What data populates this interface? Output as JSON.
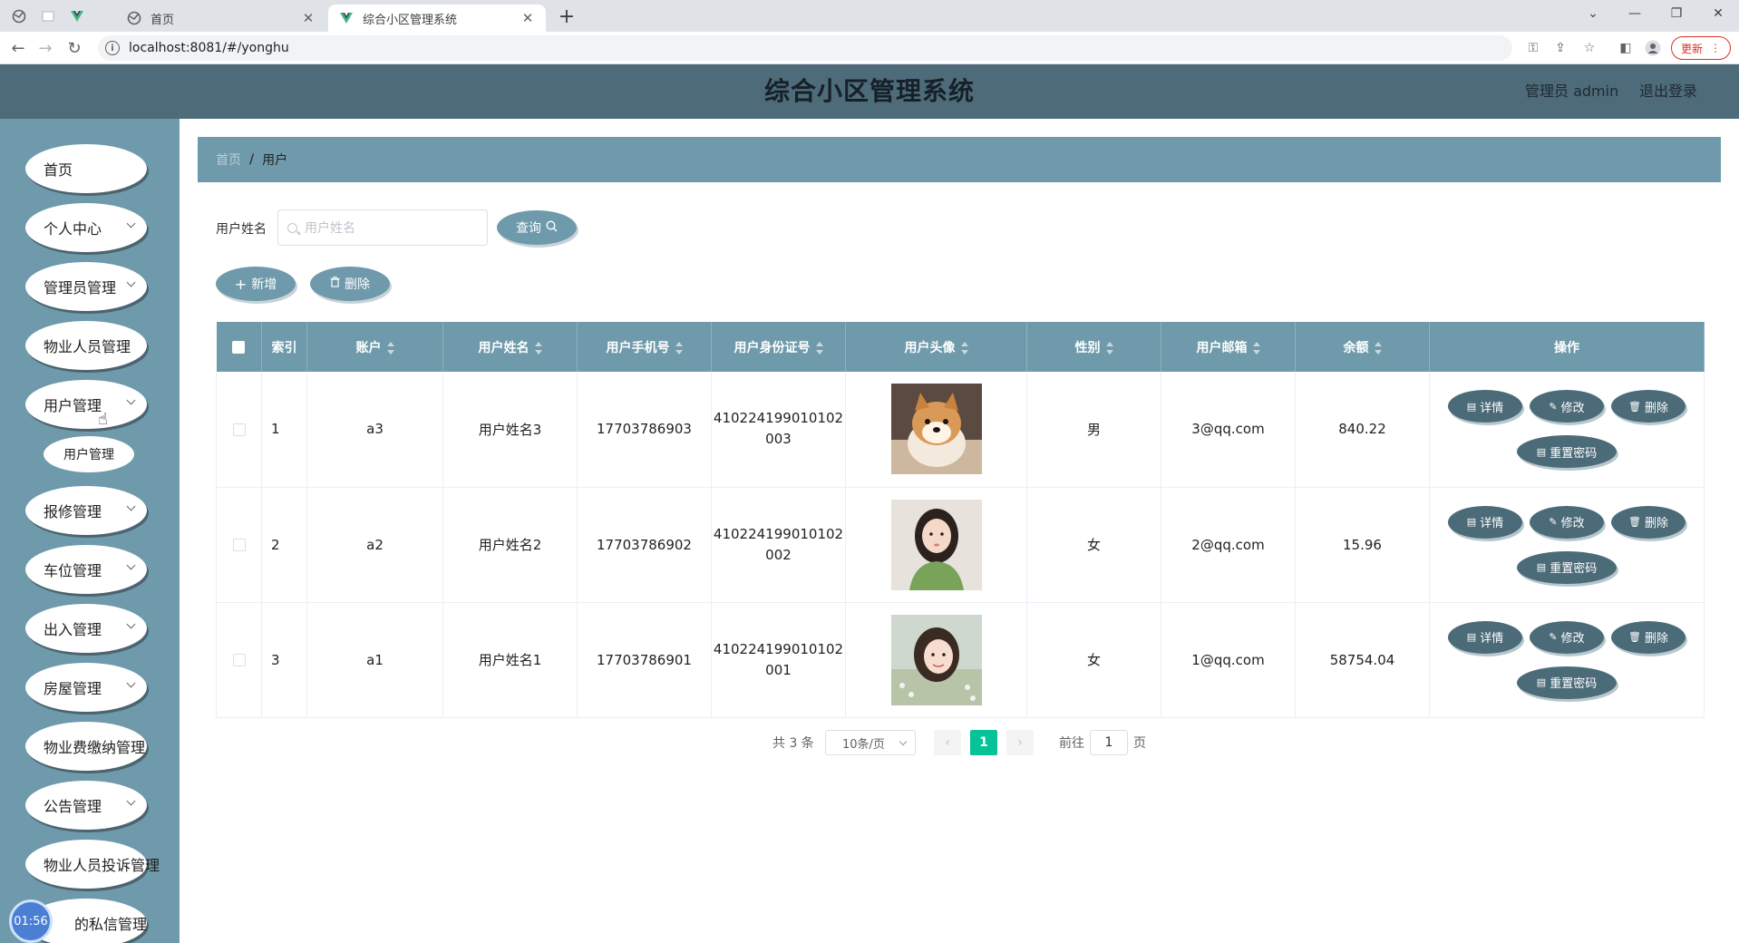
{
  "browser": {
    "tabs": [
      {
        "title": "首页",
        "active": false
      },
      {
        "title": "综合小区管理系统",
        "active": true
      }
    ],
    "url": "localhost:8081/#/yonghu",
    "update_label": "更新"
  },
  "header": {
    "title": "综合小区管理系统",
    "user": "管理员 admin",
    "logout": "退出登录"
  },
  "sidebar": {
    "items": [
      {
        "label": "首页",
        "has_arrow": false
      },
      {
        "label": "个人中心",
        "has_arrow": true
      },
      {
        "label": "管理员管理",
        "has_arrow": true
      },
      {
        "label": "物业人员管理",
        "has_arrow": false
      },
      {
        "label": "用户管理",
        "has_arrow": true
      },
      {
        "label": "报修管理",
        "has_arrow": true
      },
      {
        "label": "车位管理",
        "has_arrow": true
      },
      {
        "label": "出入管理",
        "has_arrow": true
      },
      {
        "label": "房屋管理",
        "has_arrow": true
      },
      {
        "label": "物业费缴纳管理",
        "has_arrow": false
      },
      {
        "label": "公告管理",
        "has_arrow": true
      },
      {
        "label": "物业人员投诉管理",
        "has_arrow": false
      },
      {
        "label": "的私信管理",
        "has_arrow": false
      }
    ],
    "submenu": {
      "label": "用户管理"
    },
    "timer": "01:56"
  },
  "breadcrumb": {
    "home": "首页",
    "separator": "/",
    "current": "用户"
  },
  "search": {
    "label": "用户姓名",
    "placeholder": "用户姓名",
    "button": "查询"
  },
  "actions": {
    "add": "新增",
    "delete": "删除"
  },
  "table": {
    "columns": [
      "索引",
      "账户",
      "用户姓名",
      "用户手机号",
      "用户身份证号",
      "用户头像",
      "性别",
      "用户邮箱",
      "余额",
      "操作"
    ],
    "rows": [
      {
        "index": "1",
        "account": "a3",
        "name": "用户姓名3",
        "phone": "17703786903",
        "id_line1": "410224199010102",
        "id_line2": "003",
        "avatar": "dog",
        "gender": "男",
        "email": "3@qq.com",
        "balance": "840.22"
      },
      {
        "index": "2",
        "account": "a2",
        "name": "用户姓名2",
        "phone": "17703786902",
        "id_line1": "410224199010102",
        "id_line2": "002",
        "avatar": "girl-green",
        "gender": "女",
        "email": "2@qq.com",
        "balance": "15.96"
      },
      {
        "index": "3",
        "account": "a1",
        "name": "用户姓名1",
        "phone": "17703786901",
        "id_line1": "410224199010102",
        "id_line2": "001",
        "avatar": "girl-flowers",
        "gender": "女",
        "email": "1@qq.com",
        "balance": "58754.04"
      }
    ],
    "row_actions": {
      "detail": "详情",
      "edit": "修改",
      "delete": "删除",
      "reset": "重置密码"
    }
  },
  "pagination": {
    "total": "共 3 条",
    "page_size": "10条/页",
    "current_page": "1",
    "goto_label": "前往",
    "goto_value": "1",
    "page_suffix": "页"
  },
  "colors": {
    "header_bg": "#4d6b78",
    "sidebar_bg": "#6e9aab",
    "table_header_bg": "#6e9aab",
    "op_button_bg": "#4b6b78",
    "pager_active": "#05c396"
  }
}
